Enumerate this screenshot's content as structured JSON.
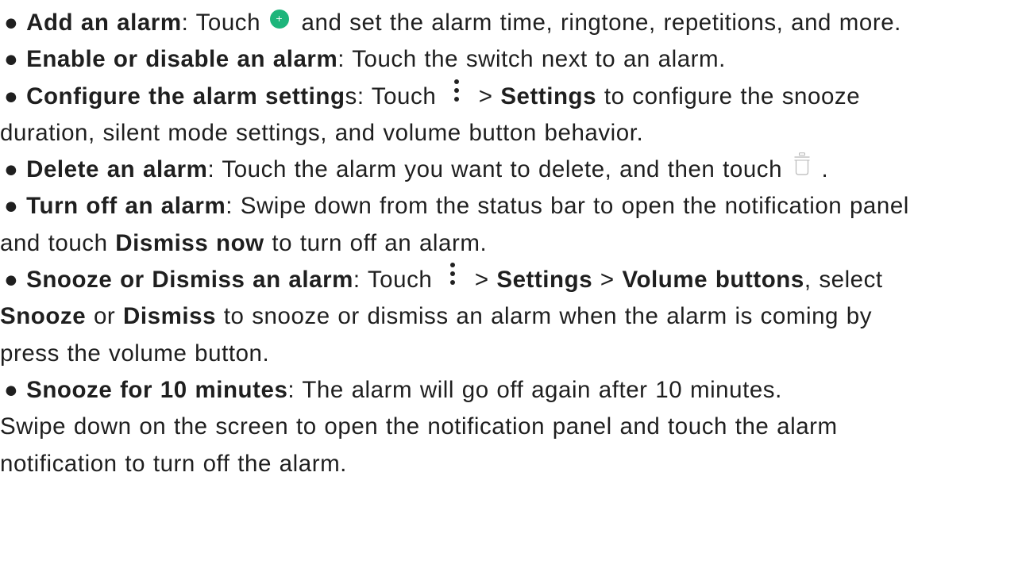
{
  "bullet": "●",
  "items": [
    {
      "title": "Add an alarm",
      "pre": ": Touch ",
      "icon": "add-circle-icon",
      "post": " and set the alarm time, ringtone, repetitions, and more."
    },
    {
      "title": "Enable or disable an alarm",
      "text": ": Touch the switch next to an alarm."
    },
    {
      "title": "Configure the alarm setting",
      "title_tail": "s",
      "pre": ": Touch ",
      "icon": "more-vertical-icon",
      "sep": " > ",
      "bold_settings": "Settings",
      "post": " to configure the snooze",
      "line2": "duration, silent mode settings, and volume button behavior."
    },
    {
      "title": "Delete an alarm",
      "pre": ": Touch the alarm you want to delete, and then touch ",
      "icon": "trash-icon",
      "post": " ."
    },
    {
      "title": "Turn off an alarm",
      "text": ": Swipe down from the status bar to open the notification panel",
      "line2_pre": "and touch ",
      "line2_bold": "Dismiss now",
      "line2_post": " to turn off an alarm."
    },
    {
      "title": "Snooze or Dismiss an alarm",
      "pre": ": Touch ",
      "icon": "more-vertical-icon",
      "sep1": " > ",
      "bold1": "Settings",
      "sep2": " > ",
      "bold2": "Volume buttons",
      "post": ", select",
      "line2_bold1": "Snooze",
      "line2_mid": " or ",
      "line2_bold2": "Dismiss",
      "line2_post": " to snooze or dismiss an alarm when the alarm is coming by",
      "line3": "press the volume button."
    },
    {
      "title": "Snooze for 10 minutes",
      "text": ": The alarm will go off again after 10 minutes.",
      "line2": "Swipe down on the screen to open the notification panel and touch the alarm",
      "line3": "notification to turn off the alarm."
    }
  ],
  "colors": {
    "text": "#1f1f1f",
    "add_icon": "#1db57b"
  }
}
